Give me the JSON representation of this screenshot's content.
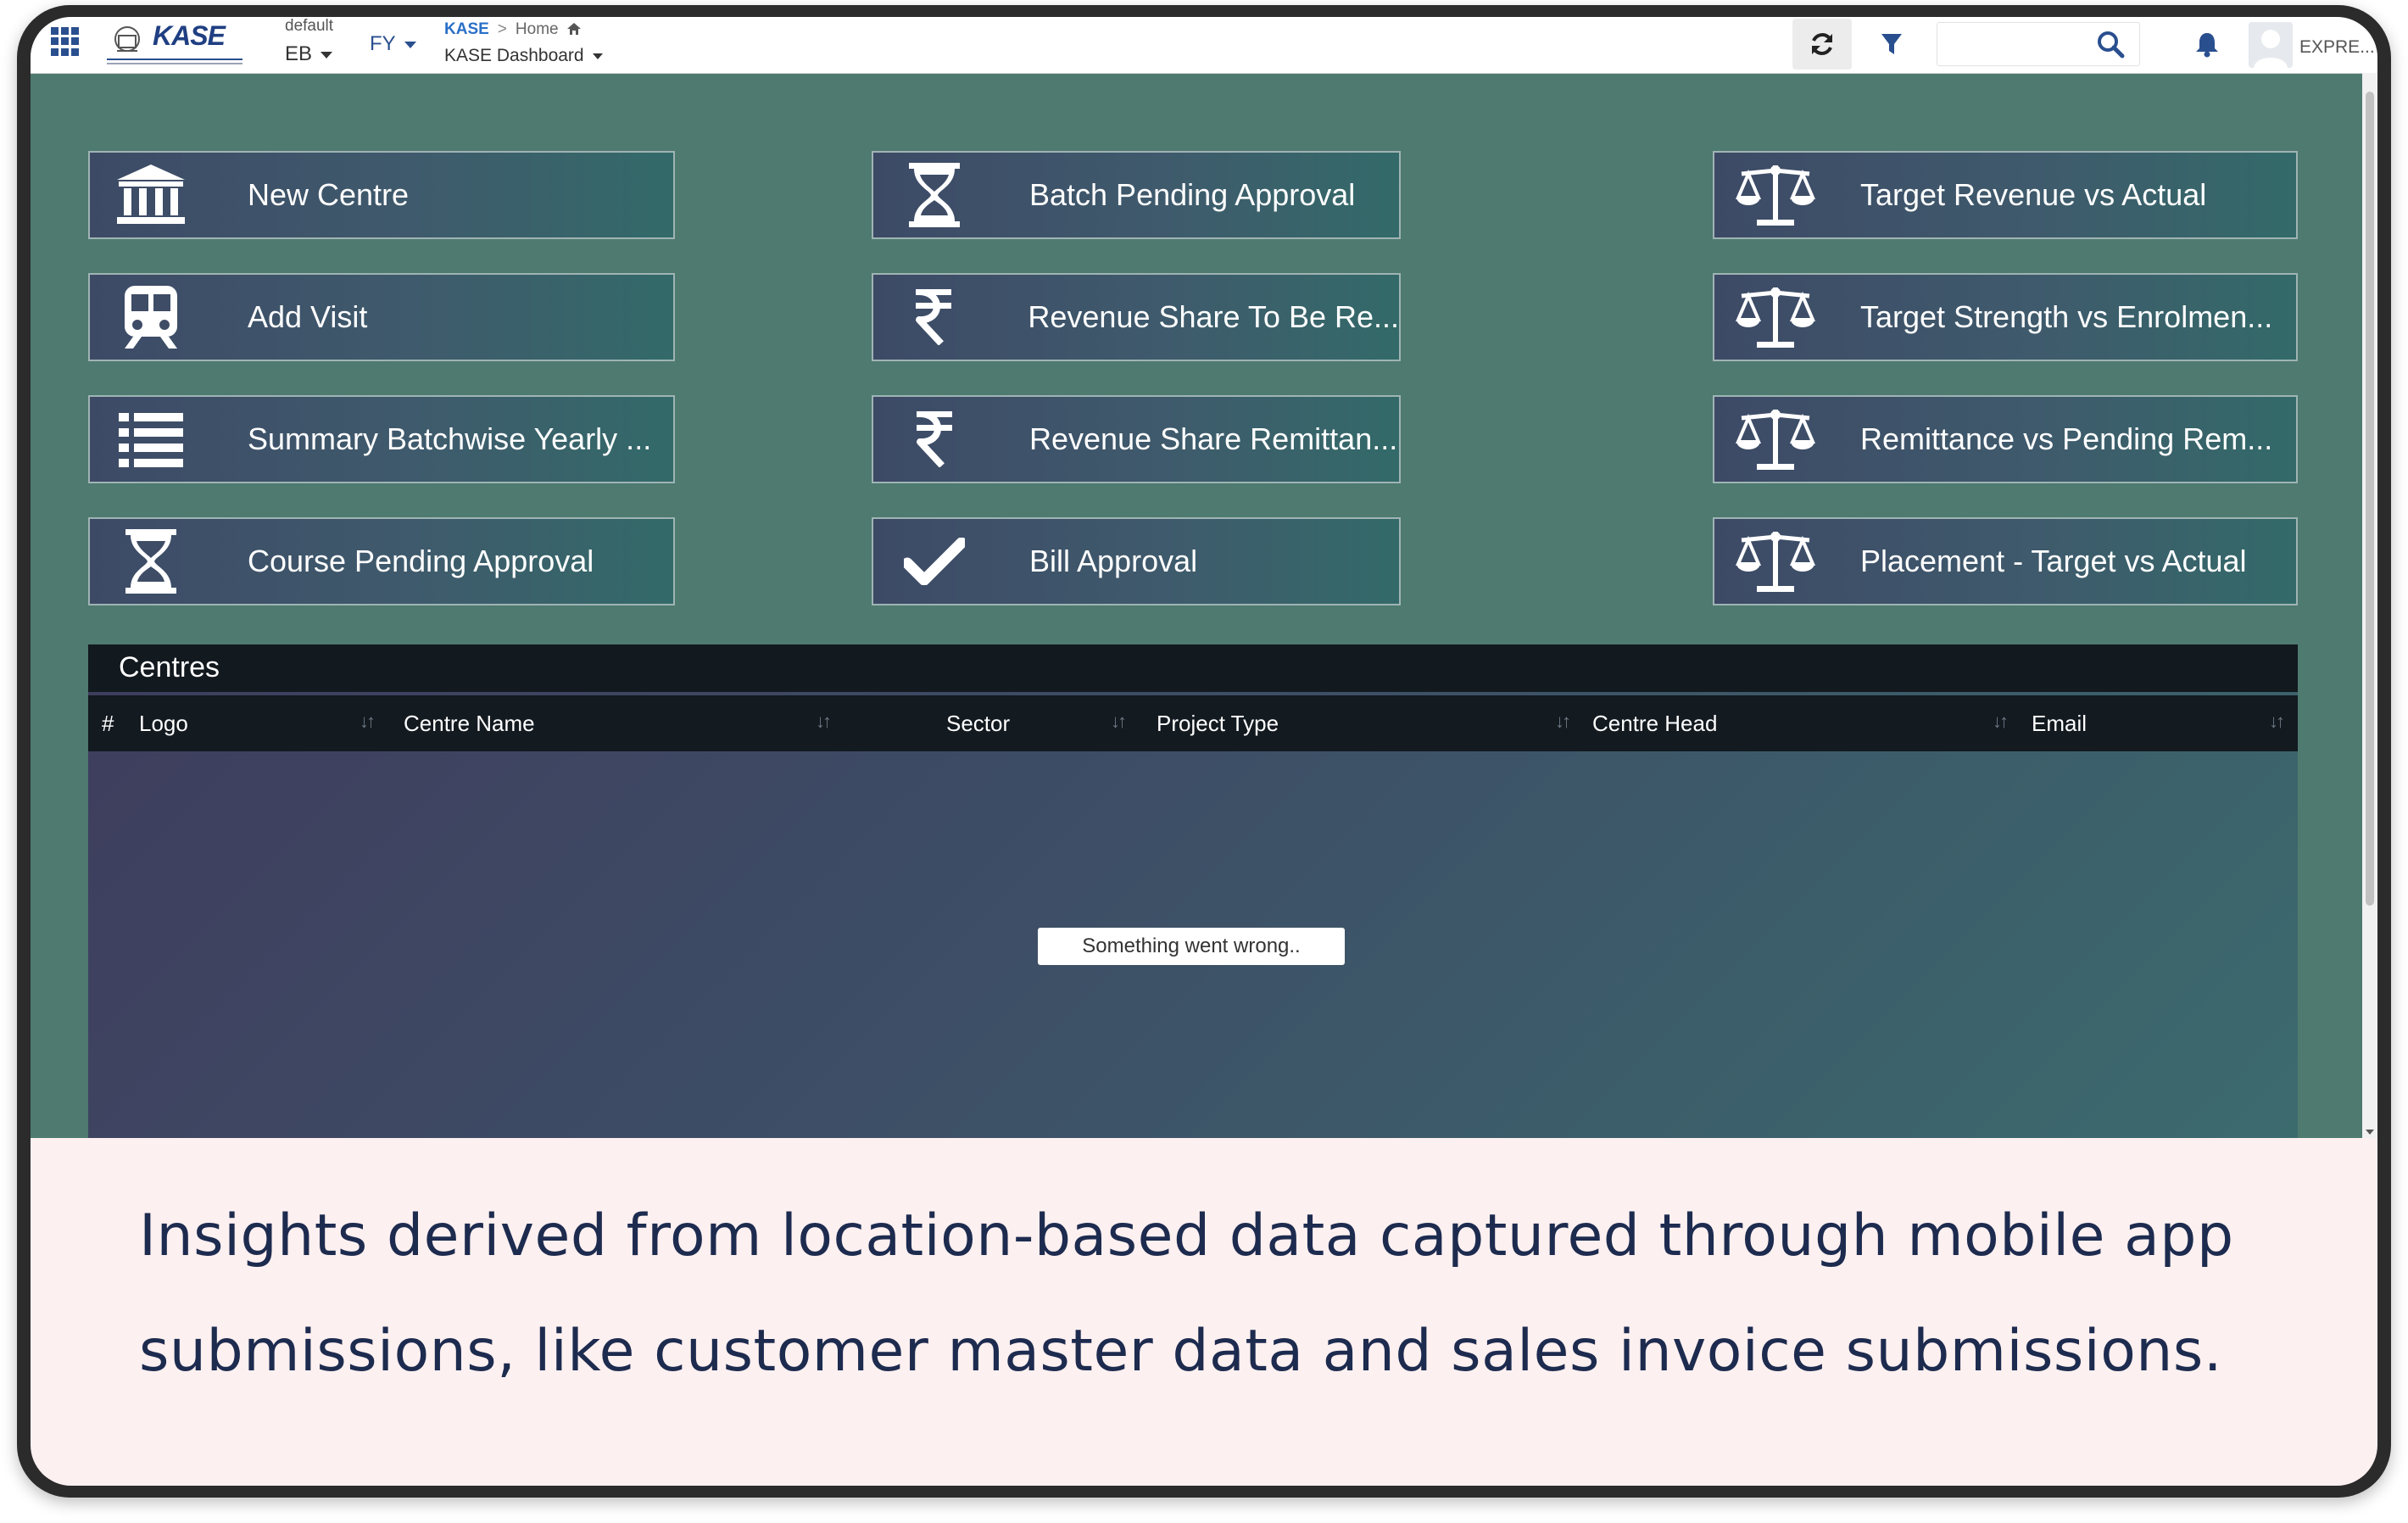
{
  "topbar": {
    "default_label": "default",
    "eb_label": "EB",
    "fy_label": "FY",
    "breadcrumb_app": "KASE",
    "breadcrumb_sep": ">",
    "breadcrumb_home": "Home",
    "dashboard_selector": "KASE Dashboard",
    "search_placeholder": "",
    "user_name": "EXPRE..."
  },
  "logo": {
    "brand": "KASE"
  },
  "tiles": [
    {
      "label": "New Centre",
      "icon": "bank-icon"
    },
    {
      "label": "Add Visit",
      "icon": "train-icon"
    },
    {
      "label": "Summary Batchwise Yearly ...",
      "icon": "list-icon"
    },
    {
      "label": "Course Pending Approval",
      "icon": "hourglass-icon"
    },
    {
      "label": "Batch Pending Approval",
      "icon": "hourglass-icon"
    },
    {
      "label": "Revenue Share To Be Re...",
      "icon": "rupee-icon"
    },
    {
      "label": "Revenue Share Remittan...",
      "icon": "rupee-icon"
    },
    {
      "label": "Bill Approval",
      "icon": "check-icon"
    },
    {
      "label": "Target Revenue vs Actual",
      "icon": "balance-scale-icon"
    },
    {
      "label": "Target Strength vs Enrolmen...",
      "icon": "balance-scale-icon"
    },
    {
      "label": "Remittance vs Pending Rem...",
      "icon": "balance-scale-icon"
    },
    {
      "label": "Placement - Target vs Actual",
      "icon": "balance-scale-icon"
    }
  ],
  "centres": {
    "title": "Centres",
    "columns": [
      "#",
      "Logo",
      "Centre Name",
      "Sector",
      "Project Type",
      "Centre Head",
      "Email"
    ],
    "error_message": "Something went wrong.."
  },
  "caption": {
    "line1": "Insights derived from location-based data captured through mobile app",
    "line2": "submissions, like customer master data and sales invoice submissions."
  },
  "colors": {
    "app_background": "#4e7a70",
    "tile_gradient_start": "#3d4a66",
    "tile_gradient_end": "#336a69",
    "table_header": "#131a20",
    "caption_background": "#fdf0f0",
    "caption_text": "#1d2b4f",
    "accent_blue": "#2a4f8f"
  }
}
